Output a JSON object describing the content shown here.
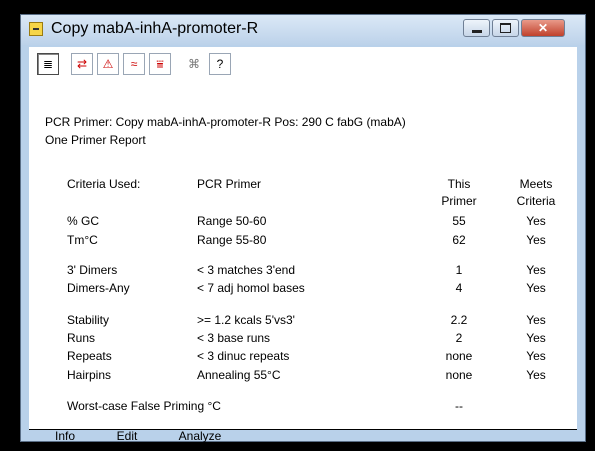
{
  "window": {
    "title": "Copy mabA-inhA-promoter-R"
  },
  "toolbar": {
    "buttons": [
      {
        "icon": "document-icon",
        "glyph": "≣"
      },
      {
        "icon": "arrows-icon",
        "glyph": "⇄"
      },
      {
        "icon": "warning-icon",
        "glyph": "⚠"
      },
      {
        "icon": "primer-icon",
        "glyph": "≈"
      },
      {
        "icon": "parallel-icon",
        "glyph": "⩸"
      },
      {
        "icon": "dna-icon",
        "glyph": "⌘"
      },
      {
        "icon": "help-icon",
        "glyph": "?"
      }
    ]
  },
  "report": {
    "line1": "PCR Primer:  Copy mabA-inhA-promoter-R  Pos: 290 C   fabG (mabA)",
    "line2": "One Primer Report"
  },
  "table": {
    "headers": {
      "criteria": "Criteria Used:",
      "pcr": "PCR Primer",
      "this": [
        "This",
        "Primer"
      ],
      "meets": [
        "Meets",
        "Criteria"
      ]
    },
    "rows": [
      {
        "criteria": "% GC",
        "pcr": "Range 50-60",
        "this": "55",
        "meets": "Yes"
      },
      {
        "criteria": "Tm°C",
        "pcr": "Range 55-80",
        "this": "62",
        "meets": "Yes"
      },
      {
        "criteria": "3' Dimers",
        "pcr": "< 3 matches 3'end",
        "this": "1",
        "meets": "Yes"
      },
      {
        "criteria": "Dimers-Any",
        "pcr": "< 7 adj homol bases",
        "this": "4",
        "meets": "Yes"
      },
      {
        "criteria": "Stability",
        "pcr": ">= 1.2 kcals 5'vs3'",
        "this": "2.2",
        "meets": "Yes"
      },
      {
        "criteria": "Runs",
        "pcr": "< 3 base runs",
        "this": "2",
        "meets": "Yes"
      },
      {
        "criteria": "Repeats",
        "pcr": "< 3 dinuc repeats",
        "this": "none",
        "meets": "Yes"
      },
      {
        "criteria": "Hairpins",
        "pcr": "Annealing 55°C",
        "this": "none",
        "meets": "Yes"
      }
    ],
    "footer": {
      "label": "Worst-case False Priming °C",
      "value": "--"
    }
  },
  "tabs": [
    {
      "label": "Info"
    },
    {
      "label": "Edit"
    },
    {
      "label": "Analyze"
    }
  ]
}
